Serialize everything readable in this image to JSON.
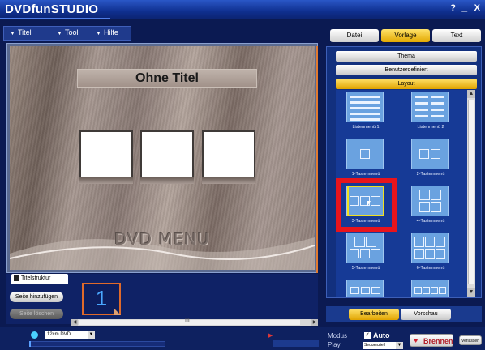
{
  "window": {
    "title": "DVDfunSTUDIO",
    "help": "?",
    "minimize": "_",
    "close": "X"
  },
  "menubar": {
    "items": [
      "Titel",
      "Tool",
      "Hilfe"
    ]
  },
  "preview": {
    "title_text": "Ohne Titel",
    "footer_text": "DVD MENU"
  },
  "pagebar": {
    "tab_label": "Titelstruktur",
    "add_page": "Seite hinzufügen",
    "delete_page": "Seite löschen",
    "page_number": "1",
    "scroll_grip": "III"
  },
  "statusbar": {
    "disc_type": "12cm DVD",
    "mode_label": "Modus",
    "play_label": "Play",
    "auto_label": "Auto",
    "play_select": "Sequenziell",
    "burn_button": "Brennen",
    "exit_button": "Verlassen"
  },
  "top_tabs": {
    "datei": "Datei",
    "vorlage": "Vorlage",
    "text": "Text",
    "active": "Vorlage"
  },
  "accordion": {
    "thema": "Thema",
    "benutzerdefiniert": "Benutzerdefiniert",
    "layout": "Layout",
    "active": "Layout"
  },
  "layouts": [
    {
      "label": "Listenmenü 1"
    },
    {
      "label": "Listenmenü 2"
    },
    {
      "label": "1-Tastenmenü"
    },
    {
      "label": "2-Tastenmenü"
    },
    {
      "label": "3-Tastenmenü"
    },
    {
      "label": "4-Tastenmenü"
    },
    {
      "label": "5-Tastenmenü"
    },
    {
      "label": "6-Tastenmenü"
    },
    {
      "label": ""
    },
    {
      "label": ""
    }
  ],
  "selected_layout": "3-Tastenmenü",
  "bottom_tabs": {
    "bearbeiten": "Bearbeiten",
    "vorschau": "Vorschau",
    "active": "Bearbeiten"
  },
  "colors": {
    "accent_yellow": "#e8b400",
    "highlight_red": "#e8141c",
    "panel_blue": "#163a96"
  }
}
